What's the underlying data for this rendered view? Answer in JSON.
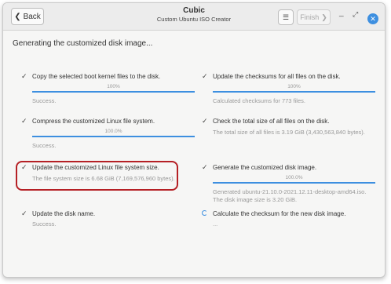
{
  "window": {
    "back_label": "Back",
    "title": "Cubic",
    "subtitle": "Custom Ubuntu ISO Creator",
    "finish_label": "Finish",
    "list_icon": "list-icon",
    "close_icon": "close-icon"
  },
  "heading": "Generating the customized disk image...",
  "tasks": [
    {
      "label": "Copy the selected boot kernel files to the disk.",
      "progress": "100%",
      "status": "Success.",
      "state": "done",
      "progress_fraction": 1.0
    },
    {
      "label": "Update the checksums for all files on the disk.",
      "progress": "100%",
      "status": "Calculated checksums for 773 files.",
      "state": "done",
      "progress_fraction": 1.0
    },
    {
      "label": "Compress the customized Linux file system.",
      "progress": "100.0%",
      "status": "Success.",
      "state": "done",
      "progress_fraction": 1.0
    },
    {
      "label": "Check the total size of all files on the disk.",
      "status": "The total size of all files is 3.19 GiB (3,430,563,840 bytes).",
      "state": "done"
    },
    {
      "label": "Update the customized Linux file system size.",
      "status": "The file system size is 6.68 GiB (7,169,576,960 bytes).",
      "state": "done"
    },
    {
      "label": "Generate the customized disk image.",
      "progress": "100.0%",
      "status": "Generated ubuntu-21.10.0-2021.12.11-desktop-amd64.iso.",
      "status2": "The disk image size is 3.20 GiB.",
      "state": "done",
      "progress_fraction": 1.0
    },
    {
      "label": "Update the disk name.",
      "status": "Success.",
      "state": "done"
    },
    {
      "label": "Calculate the checksum for the new disk image.",
      "status": "...",
      "state": "running"
    }
  ],
  "colors": {
    "accent": "#3d8fe0",
    "highlight": "#b52025"
  }
}
